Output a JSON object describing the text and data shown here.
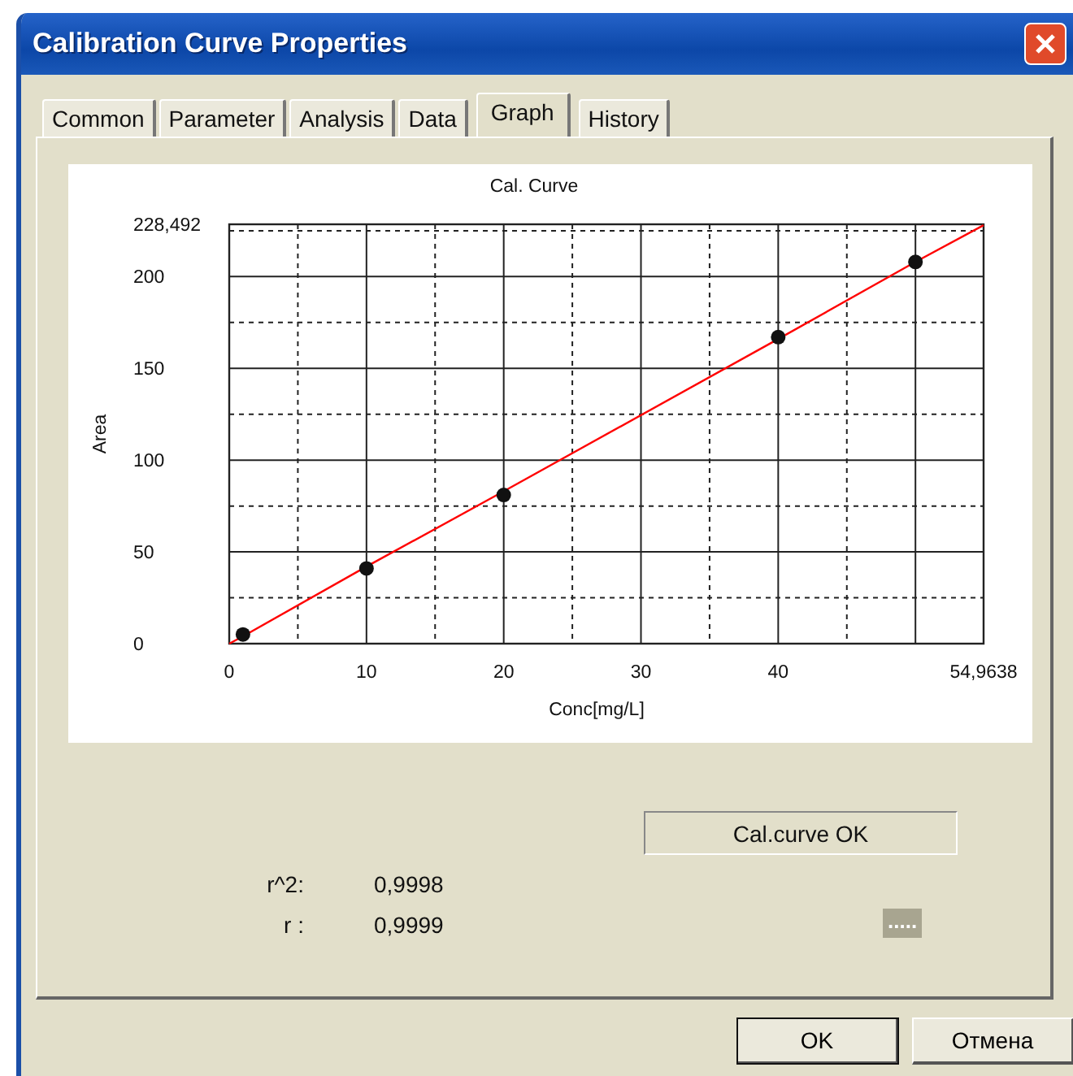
{
  "window": {
    "title": "Calibration Curve Properties"
  },
  "tabs": [
    {
      "label": "Common",
      "selected": false
    },
    {
      "label": "Parameter",
      "selected": false
    },
    {
      "label": "Analysis",
      "selected": false
    },
    {
      "label": "Data",
      "selected": false
    },
    {
      "label": "Graph",
      "selected": true
    },
    {
      "label": "History",
      "selected": false
    }
  ],
  "graph": {
    "chart_data": {
      "type": "scatter",
      "title": "Cal. Curve",
      "xlabel": "Conc[mg/L]",
      "ylabel": "Area",
      "x": [
        0,
        1,
        10,
        20,
        40,
        50,
        54.9638
      ],
      "grid": true,
      "series": [
        {
          "type": "line",
          "color": "#ff0000",
          "values": [
            0,
            4,
            42,
            83,
            166,
            208,
            228
          ]
        },
        {
          "type": "scatter",
          "color": "#111111",
          "values": [
            null,
            5,
            41,
            81,
            167,
            208,
            null
          ]
        }
      ],
      "xlim": [
        0,
        54.9638
      ],
      "ylim": [
        0,
        228.492
      ],
      "xticks": [
        0,
        10,
        20,
        30,
        40,
        {
          "value": 54.9638,
          "label": "54,9638"
        }
      ],
      "yticks": [
        0,
        50,
        100,
        150,
        200
      ],
      "annotations": [
        "228,492"
      ]
    }
  },
  "status": "Cal.curve OK",
  "stats": [
    {
      "label": "r^2:",
      "value": "0,9998"
    },
    {
      "label": "r :",
      "value": "0,9999"
    }
  ],
  "note": ".....",
  "buttons": [
    {
      "label": "OK",
      "default": true
    },
    {
      "label": "Отмена",
      "default": false
    }
  ]
}
